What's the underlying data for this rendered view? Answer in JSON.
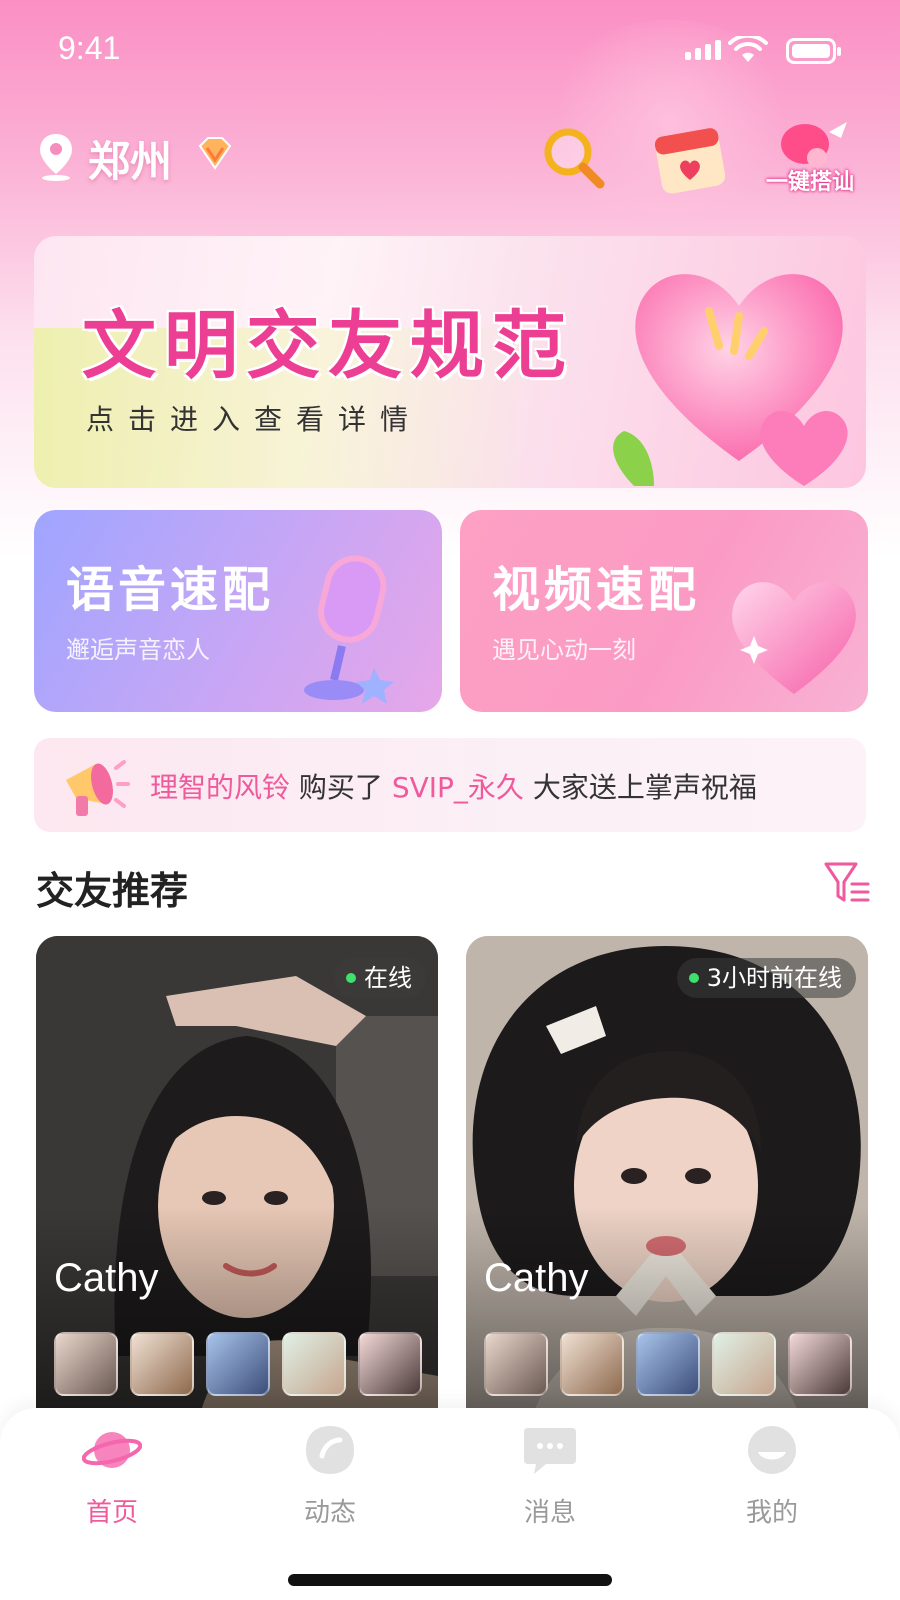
{
  "status_bar": {
    "time": "9:41"
  },
  "header": {
    "city": "郑州",
    "quick_match_label": "一键搭讪"
  },
  "banner": {
    "title": "文明交友规范",
    "subtitle": "点击进入查看详情"
  },
  "match_cards": [
    {
      "title": "语音速配",
      "subtitle": "邂逅声音恋人"
    },
    {
      "title": "视频速配",
      "subtitle": "遇见心动一刻"
    }
  ],
  "notice": {
    "user": "理智的风铃",
    "action": "购买了",
    "item": "SVIP_永久",
    "message": "大家送上掌声祝福"
  },
  "section": {
    "title": "交友推荐"
  },
  "profiles": [
    {
      "name": "Cathy",
      "status": "在线"
    },
    {
      "name": "Cathy",
      "status": "3小时前在线"
    }
  ],
  "tabs": [
    {
      "label": "首页",
      "active": true
    },
    {
      "label": "动态",
      "active": false
    },
    {
      "label": "消息",
      "active": false
    },
    {
      "label": "我的",
      "active": false
    }
  ],
  "colors": {
    "accent_pink": "#ef5a9d",
    "online_green": "#3ee16b",
    "tab_inactive": "#9a9a9a"
  },
  "icons": {
    "location": "location-pin-icon",
    "vip": "vip-diamond-icon",
    "search": "search-icon",
    "calendar": "calendar-heart-icon",
    "quick_match": "quick-greet-icon",
    "filter": "filter-icon",
    "horn": "megaphone-icon"
  }
}
